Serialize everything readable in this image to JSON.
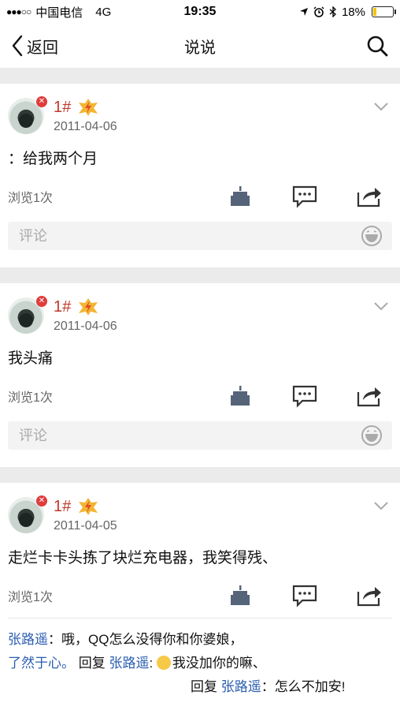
{
  "status_bar": {
    "signal": "●●●○○",
    "carrier": "中国电信",
    "network": "4G",
    "time": "19:35",
    "battery": "18%",
    "battery_level": 0.18
  },
  "nav": {
    "back_label": "返回",
    "title": "说说"
  },
  "posts": [
    {
      "username": "1#",
      "date": "2011-04-06",
      "text": "：给我两个月",
      "views": "浏览1次",
      "comment_placeholder": "评论"
    },
    {
      "username": "1#",
      "date": "2011-04-06",
      "text": "我头痛",
      "views": "浏览1次",
      "comment_placeholder": "评论"
    },
    {
      "username": "1#",
      "date": "2011-04-05",
      "text": "走烂卡卡头拣了块烂充电器，我笑得残、",
      "views": "浏览1次",
      "replies": {
        "r1_user": "张路遥",
        "r1_text": "：哦，QQ怎么没得你和你婆娘，",
        "r2_user": "了然于心。",
        "r2_reply_word": "回复",
        "r2_target": "张路遥",
        "r2_text": "我没加你的嘛、",
        "r3_reply_word": "回复",
        "r3_target": "张路遥",
        "r3_text": "：怎么不加安!"
      }
    }
  ],
  "icons": {
    "back": "chevron-left-icon",
    "search": "search-icon",
    "vip": "vip-badge-icon",
    "expand": "chevron-down-icon",
    "like": "cake-icon",
    "comment": "comment-icon",
    "share": "share-icon",
    "emoji": "emoji-icon"
  },
  "colors": {
    "username": "#c0392b",
    "link": "#2a5db0",
    "band": "#ebebeb",
    "battery": "#f5c400"
  }
}
